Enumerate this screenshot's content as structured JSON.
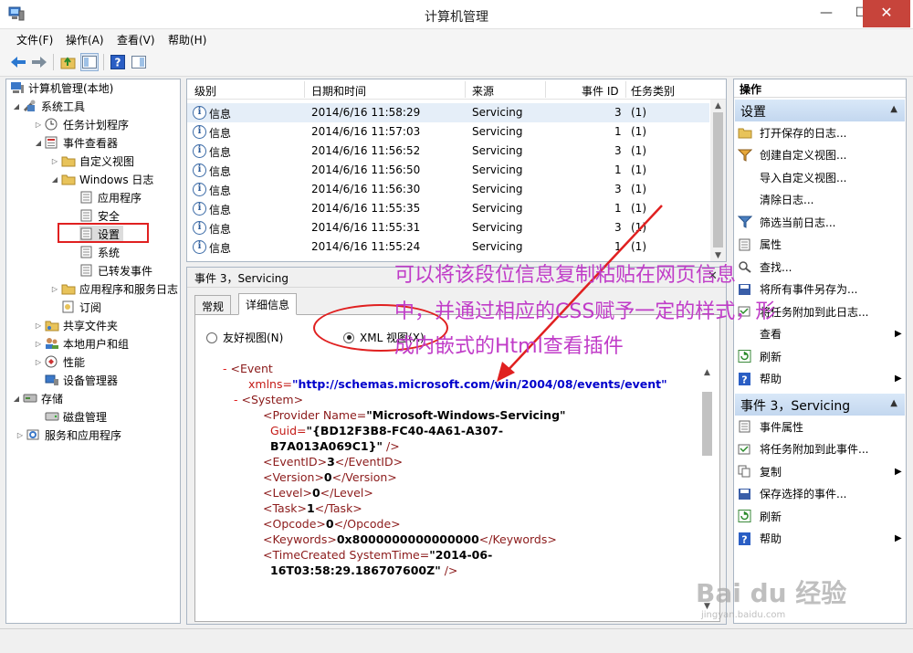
{
  "window": {
    "title": "计算机管理",
    "minimize": "—",
    "maximize": "☐",
    "close": "✕"
  },
  "menu": [
    "文件(F)",
    "操作(A)",
    "查看(V)",
    "帮助(H)"
  ],
  "tree": {
    "root": "计算机管理(本地)",
    "system_tools": "系统工具",
    "task_scheduler": "任务计划程序",
    "event_viewer": "事件查看器",
    "custom_views": "自定义视图",
    "windows_logs": "Windows 日志",
    "application": "应用程序",
    "security": "安全",
    "setup": "设置",
    "system": "系统",
    "forwarded": "已转发事件",
    "apps_services_logs": "应用程序和服务日志",
    "subscriptions": "订阅",
    "shared_folders": "共享文件夹",
    "local_users": "本地用户和组",
    "performance": "性能",
    "device_manager": "设备管理器",
    "storage": "存储",
    "disk_management": "磁盘管理",
    "services_apps": "服务和应用程序"
  },
  "events": {
    "columns": [
      "级别",
      "日期和时间",
      "来源",
      "事件 ID",
      "任务类别"
    ],
    "rows": [
      {
        "level": "信息",
        "datetime": "2014/6/16 11:58:29",
        "source": "Servicing",
        "id": "3",
        "category": "(1)"
      },
      {
        "level": "信息",
        "datetime": "2014/6/16 11:57:03",
        "source": "Servicing",
        "id": "1",
        "category": "(1)"
      },
      {
        "level": "信息",
        "datetime": "2014/6/16 11:56:52",
        "source": "Servicing",
        "id": "3",
        "category": "(1)"
      },
      {
        "level": "信息",
        "datetime": "2014/6/16 11:56:50",
        "source": "Servicing",
        "id": "1",
        "category": "(1)"
      },
      {
        "level": "信息",
        "datetime": "2014/6/16 11:56:30",
        "source": "Servicing",
        "id": "3",
        "category": "(1)"
      },
      {
        "level": "信息",
        "datetime": "2014/6/16 11:55:35",
        "source": "Servicing",
        "id": "1",
        "category": "(1)"
      },
      {
        "level": "信息",
        "datetime": "2014/6/16 11:55:31",
        "source": "Servicing",
        "id": "3",
        "category": "(1)"
      },
      {
        "level": "信息",
        "datetime": "2014/6/16 11:55:24",
        "source": "Servicing",
        "id": "1",
        "category": "(1)"
      }
    ]
  },
  "detail": {
    "title": "事件 3，Servicing",
    "close": "✕",
    "tabs": [
      "常规",
      "详细信息"
    ],
    "friendly_view": "友好视图(N)",
    "xml_view": "XML 视图(X)",
    "xml": {
      "minus": "-",
      "event_tag": "<Event",
      "xmlns_attr": "xmlns=",
      "xmlns_val": "\"http://schemas.microsoft.com/win/2004/08/events/event\"",
      "system_tag": "<System>",
      "provider_open": "<Provider Name=",
      "provider_name": "\"Microsoft-Windows-Servicing\"",
      "guid_attr": "Guid=",
      "guid_val_1": "\"{BD12F3B8-FC40-4A61-A307-",
      "guid_val_2": "B7A013A069C1}\"",
      "close_empty": " />",
      "eventid_open": "<EventID>",
      "eventid_val": "3",
      "eventid_close": "</EventID>",
      "version_open": "<Version>",
      "version_val": "0",
      "version_close": "</Version>",
      "level_open": "<Level>",
      "level_val": "0",
      "level_close": "</Level>",
      "task_open": "<Task>",
      "task_val": "1",
      "task_close": "</Task>",
      "opcode_open": "<Opcode>",
      "opcode_val": "0",
      "opcode_close": "</Opcode>",
      "keywords_open": "<Keywords>",
      "keywords_val": "0x8000000000000000",
      "keywords_close": "</Keywords>",
      "timecreated_open": "<TimeCreated SystemTime=",
      "timecreated_val_1": "\"2014-06-",
      "timecreated_val_2": "16T03:58:29.186707600Z\""
    }
  },
  "actions": {
    "title": "操作",
    "section1": "设置",
    "items1": [
      "打开保存的日志...",
      "创建自定义视图...",
      "导入自定义视图...",
      "清除日志...",
      "筛选当前日志...",
      "属性",
      "查找...",
      "将所有事件另存为...",
      "将任务附加到此日志...",
      "查看",
      "刷新",
      "帮助"
    ],
    "section2": "事件 3，Servicing",
    "items2": [
      "事件属性",
      "将任务附加到此事件...",
      "复制",
      "保存选择的事件...",
      "刷新",
      "帮助"
    ]
  },
  "annotation": {
    "line1": "可以将该段位信息复制粘贴在网页信息",
    "line2": "中，并通过相应的CSS赋予一定的样式，形",
    "line3": "成内嵌式的Html查看插件"
  },
  "watermark": {
    "brand": "Bai du 经验",
    "url": "jingyan.baidu.com"
  },
  "colors": {
    "annotation": "#c03cc8",
    "highlight": "#e02020",
    "section_bg": "#c9dcf1"
  }
}
